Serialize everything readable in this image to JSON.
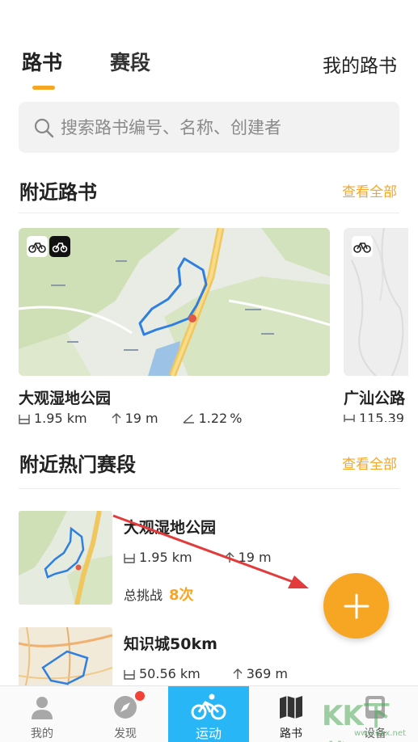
{
  "tabs": {
    "routes": "路书",
    "segments": "赛段",
    "my_routes": "我的路书"
  },
  "search": {
    "placeholder": "搜索路书编号、名称、创建者"
  },
  "nearby_routes": {
    "title": "附近路书",
    "see_all": "查看全部",
    "items": [
      {
        "name": "大观湿地公园",
        "distance": "1.95 km",
        "elevation": "19 m",
        "grade": "1.22",
        "grade_unit": "%"
      },
      {
        "name": "广汕公路",
        "distance": "115.39"
      }
    ]
  },
  "nearby_segments": {
    "title": "附近热门赛段",
    "see_all": "查看全部",
    "items": [
      {
        "name": "大观湿地公园",
        "distance": "1.95 km",
        "elevation": "19 m",
        "challenge_label": "总挑战",
        "challenge_count": "8次"
      },
      {
        "name": "知识城50km",
        "distance": "50.56 km",
        "elevation": "369 m"
      }
    ]
  },
  "bottom_nav": [
    {
      "label": "我的",
      "icon": "person-icon"
    },
    {
      "label": "发现",
      "icon": "compass-icon"
    },
    {
      "label": "运动",
      "icon": "bicycle-icon"
    },
    {
      "label": "路书",
      "icon": "map-book-icon"
    },
    {
      "label": "设备",
      "icon": "device-icon"
    }
  ],
  "watermark": {
    "text": "KK下载",
    "url": "www.kkx.net"
  },
  "colors": {
    "accent": "#f6a623",
    "active_nav": "#29b6f6",
    "route_line": "#2f7fe0",
    "notification": "#f44336"
  }
}
